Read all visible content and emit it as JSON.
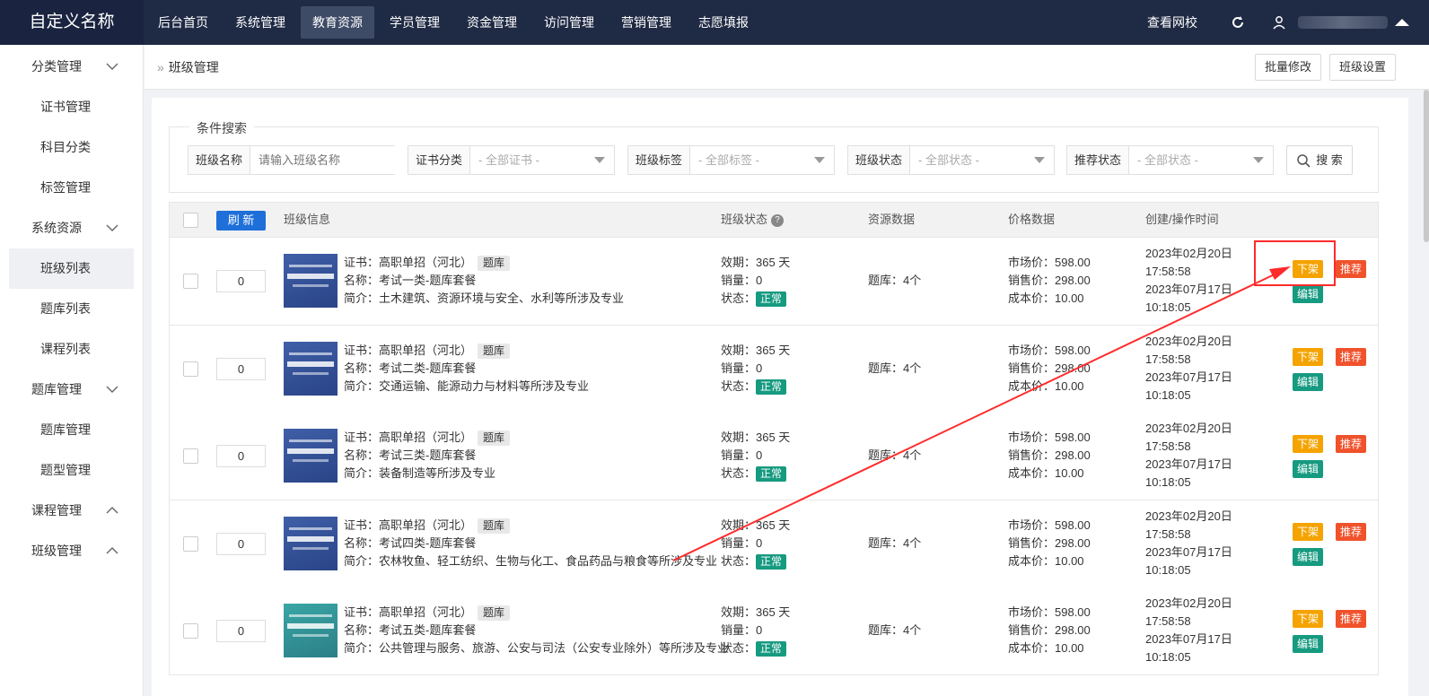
{
  "brand": "自定义名称",
  "nav": [
    "后台首页",
    "系统管理",
    "教育资源",
    "学员管理",
    "资金管理",
    "访问管理",
    "营销管理",
    "志愿填报"
  ],
  "nav_active": "教育资源",
  "topright": {
    "view_school": "查看网校"
  },
  "sidebar": {
    "groups": [
      {
        "label": "分类管理",
        "expanded": true,
        "items": [
          "证书管理",
          "科目分类",
          "标签管理"
        ]
      },
      {
        "label": "系统资源",
        "expanded": true,
        "items": [
          "班级列表",
          "题库列表",
          "课程列表"
        ]
      },
      {
        "label": "题库管理",
        "expanded": true,
        "items": [
          "题库管理",
          "题型管理"
        ]
      },
      {
        "label": "课程管理",
        "expanded": false,
        "items": []
      },
      {
        "label": "班级管理",
        "expanded": false,
        "items": []
      }
    ],
    "active_item": "班级列表"
  },
  "breadcrumb": {
    "raquo": "»",
    "title": "班级管理"
  },
  "header_buttons": {
    "bulk_edit": "批量修改",
    "settings": "班级设置"
  },
  "search": {
    "legend": "条件搜索",
    "name_label": "班级名称",
    "name_placeholder": "请输入班级名称",
    "cert_label": "证书分类",
    "cert_value": "- 全部证书 -",
    "tag_label": "班级标签",
    "tag_value": "- 全部标签 -",
    "status_label": "班级状态",
    "status_value": "- 全部状态 -",
    "recommend_label": "推荐状态",
    "recommend_value": "- 全部状态 -",
    "button": "搜 索"
  },
  "table": {
    "refresh": "刷 新",
    "headers": {
      "info": "班级信息",
      "status": "班级状态",
      "resource": "资源数据",
      "price": "价格数据",
      "time": "创建/操作时间"
    },
    "rows": [
      {
        "sort": "0",
        "cert": "证书：高职单招（河北）",
        "tag": "题库",
        "name": "名称：考试一类-题库套餐",
        "intro": "简介：土木建筑、资源环境与安全、水利等所涉及专业",
        "validity": "效期：365 天",
        "sales": "销量：0",
        "status_label": "状态：",
        "status": "正常",
        "resource": "题库：4个",
        "market": "市场价：598.00",
        "sale_price": "销售价：298.00",
        "cost": "成本价：10.00",
        "created_date": "2023年02月20日",
        "created_time": "17:58:58",
        "updated_date": "2023年07月17日",
        "updated_time": "10:18:05",
        "thumb_color": "blue"
      },
      {
        "sort": "0",
        "cert": "证书：高职单招（河北）",
        "tag": "题库",
        "name": "名称：考试二类-题库套餐",
        "intro": "简介：交通运输、能源动力与材料等所涉及专业",
        "validity": "效期：365 天",
        "sales": "销量：0",
        "status_label": "状态：",
        "status": "正常",
        "resource": "题库：4个",
        "market": "市场价：598.00",
        "sale_price": "销售价：298.00",
        "cost": "成本价：10.00",
        "created_date": "2023年02月20日",
        "created_time": "17:58:58",
        "updated_date": "2023年07月17日",
        "updated_time": "10:18:05",
        "thumb_color": "blue"
      },
      {
        "sort": "0",
        "cert": "证书：高职单招（河北）",
        "tag": "题库",
        "name": "名称：考试三类-题库套餐",
        "intro": "简介：装备制造等所涉及专业",
        "validity": "效期：365 天",
        "sales": "销量：0",
        "status_label": "状态：",
        "status": "正常",
        "resource": "题库：4个",
        "market": "市场价：598.00",
        "sale_price": "销售价：298.00",
        "cost": "成本价：10.00",
        "created_date": "2023年02月20日",
        "created_time": "17:58:58",
        "updated_date": "2023年07月17日",
        "updated_time": "10:18:05",
        "thumb_color": "blue"
      },
      {
        "sort": "0",
        "cert": "证书：高职单招（河北）",
        "tag": "题库",
        "name": "名称：考试四类-题库套餐",
        "intro": "简介：农林牧鱼、轻工纺织、生物与化工、食品药品与粮食等所涉及专业",
        "validity": "效期：365 天",
        "sales": "销量：0",
        "status_label": "状态：",
        "status": "正常",
        "resource": "题库：4个",
        "market": "市场价：598.00",
        "sale_price": "销售价：298.00",
        "cost": "成本价：10.00",
        "created_date": "2023年02月20日",
        "created_time": "17:58:58",
        "updated_date": "2023年07月17日",
        "updated_time": "10:18:05",
        "thumb_color": "blue"
      },
      {
        "sort": "0",
        "cert": "证书：高职单招（河北）",
        "tag": "题库",
        "name": "名称：考试五类-题库套餐",
        "intro": "简介：公共管理与服务、旅游、公安与司法（公安专业除外）等所涉及专业",
        "validity": "效期：365 天",
        "sales": "销量：0",
        "status_label": "状态：",
        "status": "正常",
        "resource": "题库：4个",
        "market": "市场价：598.00",
        "sale_price": "销售价：298.00",
        "cost": "成本价：10.00",
        "created_date": "2023年02月20日",
        "created_time": "17:58:58",
        "updated_date": "2023年07月17日",
        "updated_time": "10:18:05",
        "thumb_color": "teal"
      }
    ],
    "actions": {
      "off_shelf": "下架",
      "recommend": "推荐",
      "edit": "编辑"
    }
  },
  "colors": {
    "topbar": "#1f2a44",
    "primary": "#1e6fd9",
    "success": "#169a80",
    "warning": "#f5a300",
    "danger": "#f0522c",
    "annotation": "#ff2a2a"
  }
}
